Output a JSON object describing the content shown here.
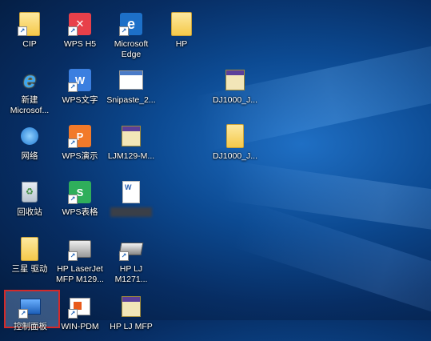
{
  "icons": {
    "cip": "CIP",
    "wps_h5": "WPS H5",
    "edge_line1": "Microsoft",
    "edge_line2": "Edge",
    "hp": "HP",
    "ie_line1": "新建",
    "ie_line2": "Microsof...",
    "wps_text": "WPS文字",
    "snipaste": "Snipaste_2...",
    "dj1": "DJ1000_J...",
    "network": "网络",
    "wps_present": "WPS演示",
    "ljm": "LJM129-M...",
    "dj2": "DJ1000_J...",
    "recycle": "回收站",
    "wps_sheet": "WPS表格",
    "samsung": "三星 驱动",
    "hp_laser_line1": "HP LaserJet",
    "hp_laser_line2": "MFP M129...",
    "hp_lj_line1": "HP LJ",
    "hp_lj_line2": "M1271...",
    "control_panel": "控制面板",
    "win_pdm": "WIN-PDM",
    "hp_mfp": "HP LJ MFP"
  },
  "colors": {
    "wps_h5": "#e8404a",
    "wps_text": "#3b7fe0",
    "wps_present": "#f27a2a",
    "wps_sheet": "#2fae5b",
    "edge": "#1d70c8",
    "selection_border": "#d32a2a"
  }
}
